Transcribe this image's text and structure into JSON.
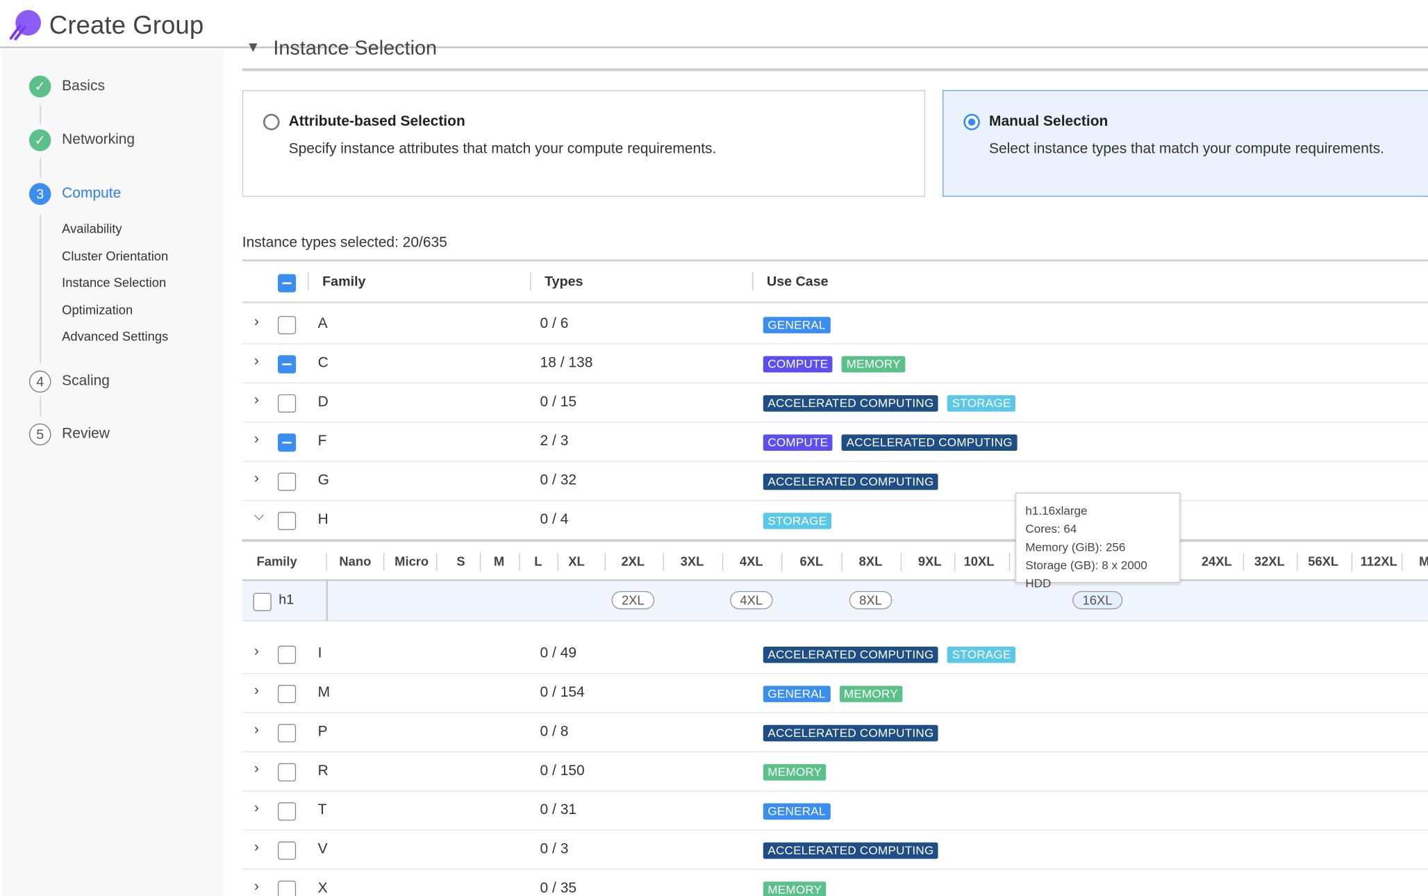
{
  "header": {
    "title": "Create Group",
    "logo": "rocket-logo"
  },
  "sidebar": {
    "steps": [
      {
        "label": "Basics",
        "state": "done",
        "num": "1"
      },
      {
        "label": "Networking",
        "state": "done",
        "num": "2"
      },
      {
        "label": "Compute",
        "state": "current",
        "num": "3"
      },
      {
        "label": "Scaling",
        "state": "todo",
        "num": "4"
      },
      {
        "label": "Review",
        "state": "todo",
        "num": "5"
      }
    ],
    "substeps": [
      "Availability",
      "Cluster Orientation",
      "Instance Selection",
      "Optimization",
      "Advanced Settings"
    ]
  },
  "section": {
    "title": "Instance Selection"
  },
  "selection_cards": [
    {
      "title": "Attribute-based Selection",
      "desc": "Specify instance attributes that match your compute requirements.",
      "selected": false
    },
    {
      "title": "Manual Selection",
      "desc": "Select instance types that match your compute requirements.",
      "selected": true
    }
  ],
  "instance_count": "Instance types selected: 20/635",
  "table": {
    "headers": {
      "family": "Family",
      "types": "Types",
      "use_case": "Use Case"
    },
    "rows": [
      {
        "family": "A",
        "types": "0 / 6",
        "use_cases": [
          "GENERAL"
        ],
        "state": "none"
      },
      {
        "family": "C",
        "types": "18 / 138",
        "use_cases": [
          "COMPUTE",
          "MEMORY"
        ],
        "state": "partial"
      },
      {
        "family": "D",
        "types": "0 / 15",
        "use_cases": [
          "ACCELERATED COMPUTING",
          "STORAGE"
        ],
        "state": "none"
      },
      {
        "family": "F",
        "types": "2 / 3",
        "use_cases": [
          "COMPUTE",
          "ACCELERATED COMPUTING"
        ],
        "state": "partial"
      },
      {
        "family": "G",
        "types": "0 / 32",
        "use_cases": [
          "ACCELERATED COMPUTING"
        ],
        "state": "none"
      },
      {
        "family": "H",
        "types": "0 / 4",
        "use_cases": [
          "STORAGE"
        ],
        "state": "none",
        "expanded": true
      },
      {
        "family": "I",
        "types": "0 / 49",
        "use_cases": [
          "ACCELERATED COMPUTING",
          "STORAGE"
        ],
        "state": "none"
      },
      {
        "family": "M",
        "types": "0 / 154",
        "use_cases": [
          "GENERAL",
          "MEMORY"
        ],
        "state": "none"
      },
      {
        "family": "P",
        "types": "0 / 8",
        "use_cases": [
          "ACCELERATED COMPUTING"
        ],
        "state": "none"
      },
      {
        "family": "R",
        "types": "0 / 150",
        "use_cases": [
          "MEMORY"
        ],
        "state": "none"
      },
      {
        "family": "T",
        "types": "0 / 31",
        "use_cases": [
          "GENERAL"
        ],
        "state": "none"
      },
      {
        "family": "V",
        "types": "0 / 3",
        "use_cases": [
          "ACCELERATED COMPUTING"
        ],
        "state": "none"
      },
      {
        "family": "X",
        "types": "0 / 35",
        "use_cases": [
          "MEMORY"
        ],
        "state": "none"
      }
    ],
    "badge_colors": {
      "GENERAL": "#3b8ef0",
      "COMPUTE": "#5b4ff0",
      "MEMORY": "#5bc08a",
      "ACCELERATED COMPUTING": "#1f4e85",
      "STORAGE": "#5bc8e8"
    }
  },
  "subtable": {
    "family_header": "Family",
    "size_headers": [
      "Nano",
      "Micro",
      "S",
      "M",
      "L",
      "XL",
      "2XL",
      "3XL",
      "4XL",
      "6XL",
      "8XL",
      "9XL",
      "10XL",
      "",
      "",
      "24XL",
      "32XL",
      "56XL",
      "112XL",
      "M"
    ],
    "row": {
      "family": "h1",
      "sizes": [
        "2XL",
        "4XL",
        "8XL",
        "16XL"
      ]
    }
  },
  "tooltip": {
    "name": "h1.16xlarge",
    "cores": "Cores: 64",
    "memory": "Memory (GiB): 256",
    "storage": "Storage (GB): 8 x 2000 HDD"
  }
}
